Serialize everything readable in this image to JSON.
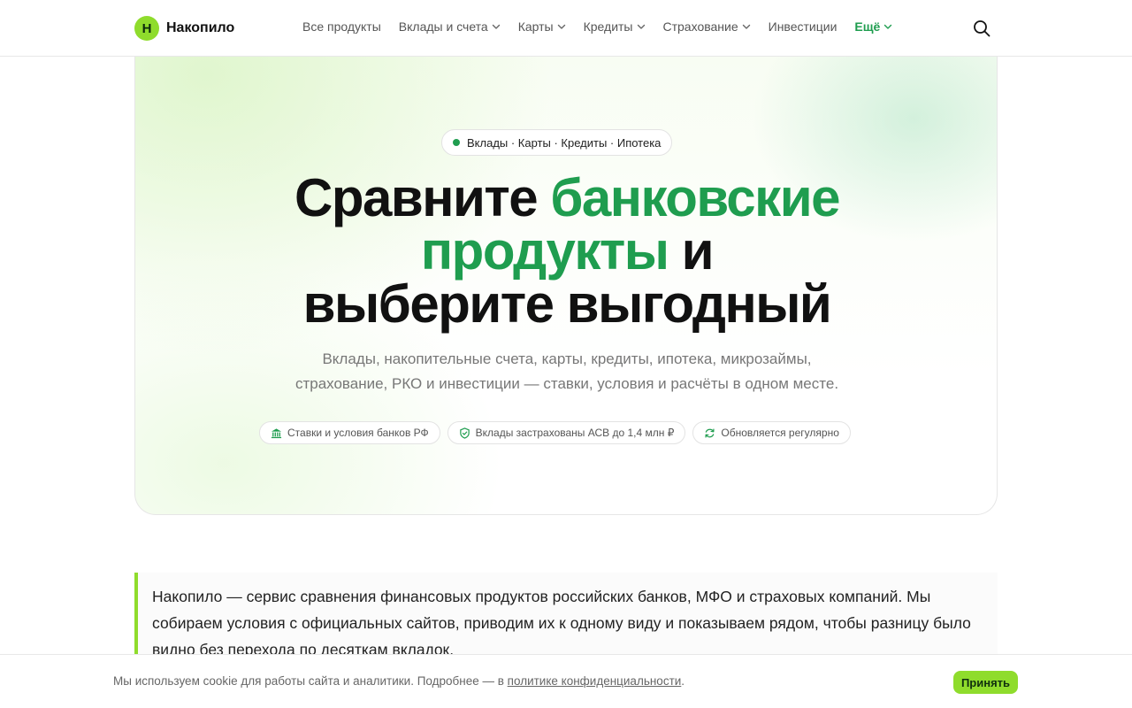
{
  "brand": {
    "logo_letter": "Н",
    "name": "Накопило"
  },
  "nav": {
    "items": [
      {
        "label": "Все продукты",
        "dropdown": false
      },
      {
        "label": "Вклады и счета",
        "dropdown": true
      },
      {
        "label": "Карты",
        "dropdown": true
      },
      {
        "label": "Кредиты",
        "dropdown": true
      },
      {
        "label": "Страхование",
        "dropdown": true
      },
      {
        "label": "Инвестиции",
        "dropdown": false
      },
      {
        "label": "Ещё",
        "dropdown": true
      }
    ],
    "search_icon": "search-icon"
  },
  "hero": {
    "pill": "Вклады · Карты · Кредиты · Ипотека",
    "headline": {
      "part1": "Сравните ",
      "part2_green": "банковские",
      "part3_green": "продукты",
      "part4": " и",
      "part5": "выберите выгодный"
    },
    "subtitle_line1": "Вклады, накопительные счета, карты, кредиты, ипотека, микрозаймы,",
    "subtitle_line2": "страхование, РКО и инвестиции — ставки, условия и расчёты в одном месте.",
    "badges": [
      {
        "icon": "bank-icon",
        "label": "Ставки и условия банков РФ"
      },
      {
        "icon": "shield-icon",
        "label": "Вклады застрахованы АСВ до 1,4 млн ₽"
      },
      {
        "icon": "refresh-icon",
        "label": "Обновляется регулярно"
      }
    ]
  },
  "about": {
    "text": "Накопило — сервис сравнения финансовых продуктов российских банков, МФО и страховых компаний. Мы собираем условия с официальных сайтов, приводим их к одному виду и показываем рядом, чтобы разницу было видно без перехода по десяткам вкладок."
  },
  "cookie": {
    "text": "Мы используем cookie для работы сайта и аналитики. Подробнее — в ",
    "link": "политике конфиденциальности",
    "text_end": ".",
    "accept_label": "Принять"
  },
  "colors": {
    "accent_green": "#1f9d4f",
    "lime": "#8fdc2c"
  }
}
